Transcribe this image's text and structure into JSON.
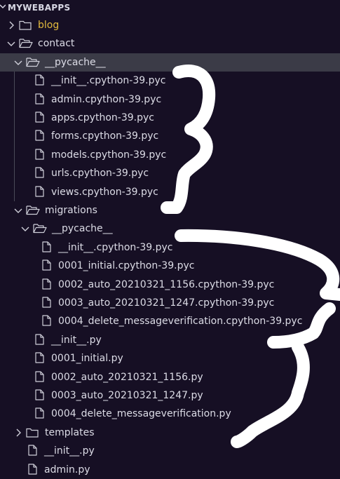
{
  "explorer": {
    "title": "MYWEBAPPS"
  },
  "tree": [
    {
      "label": "blog",
      "type": "folder",
      "depth": 0,
      "expanded": false,
      "modified": true
    },
    {
      "label": "contact",
      "type": "folder",
      "depth": 0,
      "expanded": true
    },
    {
      "label": "__pycache__",
      "type": "folder",
      "depth": 1,
      "expanded": true,
      "selected": true
    },
    {
      "label": "__init__.cpython-39.pyc",
      "type": "file",
      "depth": 2
    },
    {
      "label": "admin.cpython-39.pyc",
      "type": "file",
      "depth": 2
    },
    {
      "label": "apps.cpython-39.pyc",
      "type": "file",
      "depth": 2
    },
    {
      "label": "forms.cpython-39.pyc",
      "type": "file",
      "depth": 2
    },
    {
      "label": "models.cpython-39.pyc",
      "type": "file",
      "depth": 2
    },
    {
      "label": "urls.cpython-39.pyc",
      "type": "file",
      "depth": 2
    },
    {
      "label": "views.cpython-39.pyc",
      "type": "file",
      "depth": 2
    },
    {
      "label": "migrations",
      "type": "folder",
      "depth": 1,
      "expanded": true
    },
    {
      "label": "__pycache__",
      "type": "folder",
      "depth": 2,
      "expanded": true
    },
    {
      "label": "__init__.cpython-39.pyc",
      "type": "file",
      "depth": 3
    },
    {
      "label": "0001_initial.cpython-39.pyc",
      "type": "file",
      "depth": 3
    },
    {
      "label": "0002_auto_20210321_1156.cpython-39.pyc",
      "type": "file",
      "depth": 3
    },
    {
      "label": "0003_auto_20210321_1247.cpython-39.pyc",
      "type": "file",
      "depth": 3
    },
    {
      "label": "0004_delete_messageverification.cpython-39.pyc",
      "type": "file",
      "depth": 3
    },
    {
      "label": "__init__.py",
      "type": "file",
      "depth": 2
    },
    {
      "label": "0001_initial.py",
      "type": "file",
      "depth": 2
    },
    {
      "label": "0002_auto_20210321_1156.py",
      "type": "file",
      "depth": 2
    },
    {
      "label": "0003_auto_20210321_1247.py",
      "type": "file",
      "depth": 2
    },
    {
      "label": "0004_delete_messageverification.py",
      "type": "file",
      "depth": 2
    },
    {
      "label": "templates",
      "type": "folder",
      "depth": 1,
      "expanded": false
    },
    {
      "label": "__init__.py",
      "type": "file",
      "depth": 1
    },
    {
      "label": "admin.py",
      "type": "file",
      "depth": 1
    }
  ],
  "colors": {
    "background": "#160f24",
    "selected_row": "#3b3b47",
    "text": "#dcdce6",
    "modified_text": "#e2b93d",
    "scribble": "#ffffff"
  }
}
